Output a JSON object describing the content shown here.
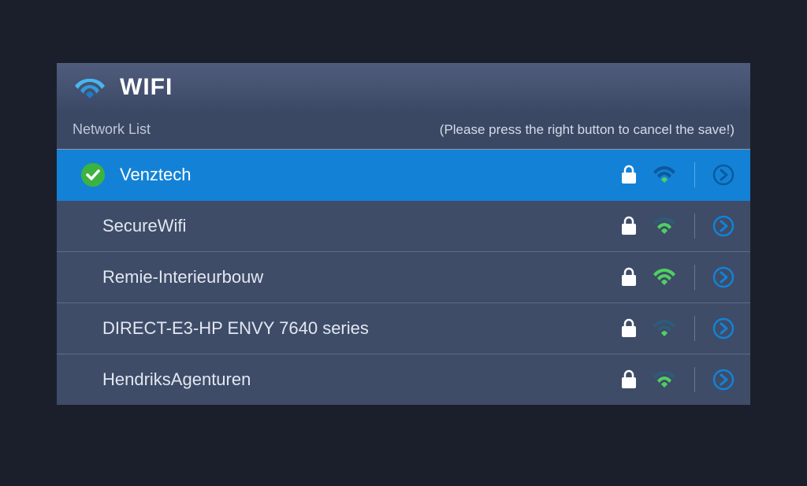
{
  "header": {
    "title": "WIFI"
  },
  "subheader": {
    "left": "Network List",
    "right": "(Please press the right button to cancel the save!)"
  },
  "networks": [
    {
      "name": "Venztech",
      "connected": true,
      "secured": true,
      "signal": 2
    },
    {
      "name": "SecureWifi",
      "connected": false,
      "secured": true,
      "signal": 3
    },
    {
      "name": "Remie-Interieurbouw",
      "connected": false,
      "secured": true,
      "signal": 4
    },
    {
      "name": "DIRECT-E3-HP ENVY 7640 series",
      "connected": false,
      "secured": true,
      "signal": 2
    },
    {
      "name": "HendriksAgenturen",
      "connected": false,
      "secured": true,
      "signal": 3
    }
  ],
  "colors": {
    "accent": "#1382d6",
    "signalActive": "#4fd060",
    "signalInactive": "#2f5a7a",
    "arrowCircle": "#1382d6"
  }
}
